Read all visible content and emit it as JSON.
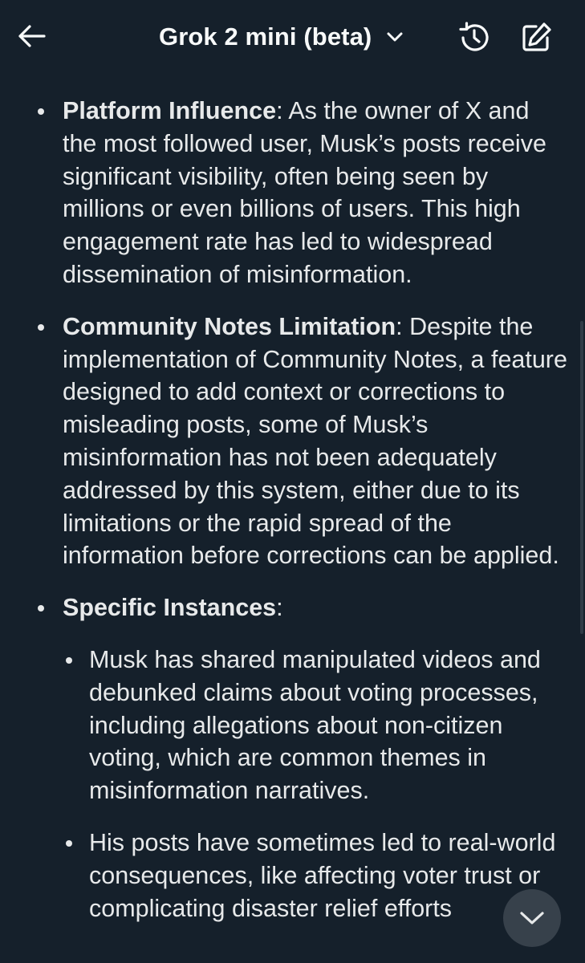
{
  "header": {
    "title": "Grok 2 mini (beta)"
  },
  "icons": {
    "back": "arrow-left-icon",
    "model_menu": "chevron-down-icon",
    "history": "history-icon",
    "compose": "compose-icon",
    "scroll_down": "chevron-down-icon"
  },
  "colors": {
    "background": "#15202b",
    "text": "#e7e9ea"
  },
  "content": {
    "items": [
      {
        "heading": "Platform Influence",
        "text": ": As the owner of X and the most followed user, Musk’s posts receive significant visibility, often being seen by millions or even billions of users. This high engagement rate has led to widespread dissemination of misinformation."
      },
      {
        "heading": "Community Notes Limitation",
        "text": ": Despite the implementation of Community Notes, a feature designed to add context or corrections to misleading posts, some of Musk’s misinformation has not been adequately addressed by this system, either due to its limitations or the rapid spread of the information before corrections can be applied."
      },
      {
        "heading": "Specific Instances",
        "text": ":",
        "subitems": [
          "Musk has shared manipulated videos and debunked claims about voting processes, including allegations about non-citizen voting, which are common themes in misinformation narratives.",
          "His posts have sometimes led to real-world consequences, like affecting voter trust or complicating disaster relief efforts"
        ]
      }
    ]
  }
}
